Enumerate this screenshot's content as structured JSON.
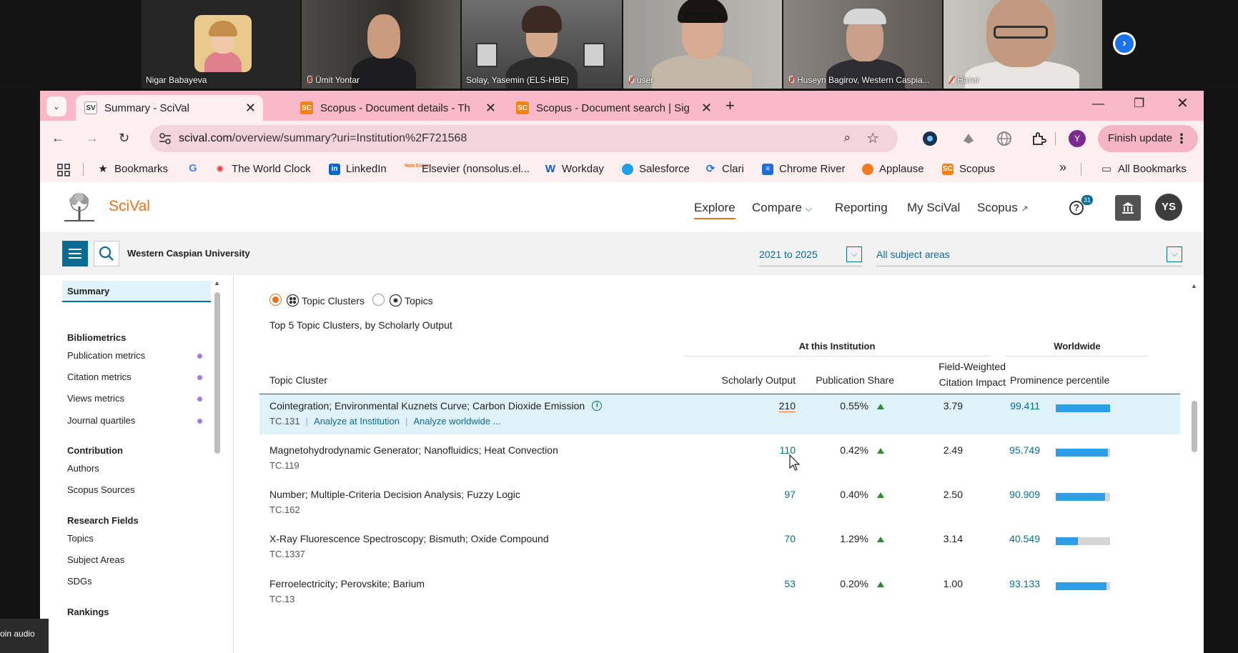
{
  "meeting": {
    "participants": [
      {
        "name": "Nigar Babayeva",
        "muted": false
      },
      {
        "name": "Ümit Yontar",
        "muted": true
      },
      {
        "name": "Solay, Yasemin (ELS-HBE)",
        "muted": false
      },
      {
        "name": "user",
        "muted": true
      },
      {
        "name": "Huseyn Bagirov, Western Caspia...",
        "muted": true
      },
      {
        "name": "Натиг",
        "muted": true
      }
    ],
    "join_audio": "oin audio"
  },
  "browser": {
    "tabs": [
      {
        "label": "Summary - SciVal",
        "favicon": "SV"
      },
      {
        "label": "Scopus - Document details - Th",
        "favicon": "SC"
      },
      {
        "label": "Scopus - Document search | Sig",
        "favicon": "SC"
      }
    ],
    "url_host": "scival.com",
    "url_path": "/overview/summary?uri=Institution%2F721568",
    "profile_initial": "Y",
    "finish_update": "Finish update",
    "bookmarks": [
      "Bookmarks",
      "The World Clock",
      "LinkedIn",
      "Elsevier (nonsolus.el...",
      "Workday",
      "Salesforce",
      "Clari",
      "Chrome River",
      "Applause",
      "Scopus"
    ],
    "all_bookmarks": "All Bookmarks",
    "bookmark_favicon_nonsolus": "Non Solus"
  },
  "scival": {
    "logo_text": "SciVal",
    "nav": [
      "Explore",
      "Compare",
      "Reporting",
      "My SciVal",
      "Scopus"
    ],
    "help_badge": "31",
    "avatar_initials": "YS",
    "entity_name": "Western Caspian University",
    "year_range": "2021 to 2025",
    "subject_areas": "All subject areas",
    "sidebar": {
      "summary": "Summary",
      "sections": [
        {
          "title": "Bibliometrics",
          "items": [
            "Publication metrics",
            "Citation metrics",
            "Views metrics",
            "Journal quartiles"
          ]
        },
        {
          "title": "Contribution",
          "items": [
            "Authors",
            "Scopus Sources"
          ]
        },
        {
          "title": "Research Fields",
          "items": [
            "Topics",
            "Subject Areas",
            "SDGs"
          ]
        },
        {
          "title": "Rankings",
          "items": []
        }
      ]
    },
    "radio": {
      "option1": "Topic Clusters",
      "option2": "Topics",
      "selected": "Topic Clusters"
    },
    "table_title": "Top 5 Topic Clusters, by Scholarly Output",
    "group_heads": {
      "institution": "At this Institution",
      "worldwide": "Worldwide"
    },
    "columns": {
      "topic": "Topic Cluster",
      "scholarly_output": "Scholarly Output",
      "publication_share": "Publication Share",
      "fwci_line1": "Field-Weighted",
      "fwci_line2": "Citation Impact",
      "prominence": "Prominence percentile"
    },
    "row_links": {
      "analyze_inst": "Analyze at Institution",
      "analyze_world": "Analyze worldwide ..."
    },
    "rows": [
      {
        "name": "Cointegration; Environmental Kuznets Curve; Carbon Dioxide Emission",
        "code": "TC.131",
        "output": "210",
        "share": "0.55%",
        "fwci": "3.79",
        "prominence": "99.411",
        "prominence_value": 99.411
      },
      {
        "name": "Magnetohydrodynamic Generator; Nanofluidics; Heat Convection",
        "code": "TC.119",
        "output": "110",
        "share": "0.42%",
        "fwci": "2.49",
        "prominence": "95.749",
        "prominence_value": 95.749
      },
      {
        "name": "Number; Multiple-Criteria Decision Analysis; Fuzzy Logic",
        "code": "TC.162",
        "output": "97",
        "share": "0.40%",
        "fwci": "2.50",
        "prominence": "90.909",
        "prominence_value": 90.909
      },
      {
        "name": "X-Ray Fluorescence Spectroscopy; Bismuth; Oxide Compound",
        "code": "TC.1337",
        "output": "70",
        "share": "1.29%",
        "fwci": "3.14",
        "prominence": "40.549",
        "prominence_value": 40.549
      },
      {
        "name": "Ferroelectricity; Perovskite; Barium",
        "code": "TC.13",
        "output": "53",
        "share": "0.20%",
        "fwci": "1.00",
        "prominence": "93.133",
        "prominence_value": 93.133
      }
    ]
  }
}
